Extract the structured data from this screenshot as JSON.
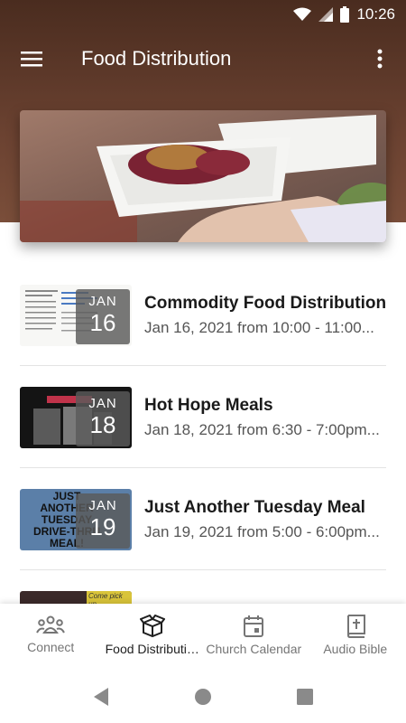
{
  "status_bar": {
    "time": "10:26"
  },
  "app_bar": {
    "title": "Food Distribution"
  },
  "events": [
    {
      "title": "Commodity Food Distribution",
      "subtitle": "Jan 16, 2021 from 10:00 - 11:00...",
      "month": "JAN",
      "day": "16"
    },
    {
      "title": "Hot Hope Meals",
      "subtitle": "Jan 18, 2021 from 6:30 - 7:00pm...",
      "month": "JAN",
      "day": "18"
    },
    {
      "title": "Just Another Tuesday Meal",
      "subtitle": "Jan 19, 2021 from 5:00 - 6:00pm...",
      "month": "JAN",
      "day": "19"
    }
  ],
  "thumbs": {
    "t3_text": "JUST ANOTHER TUESDAY DRIVE-THRU MEAL!",
    "t4_text": "Come pick up"
  },
  "bottom_nav": {
    "tabs": [
      {
        "label": "Connect",
        "icon": "people-icon"
      },
      {
        "label": "Food Distributi…",
        "icon": "box-icon"
      },
      {
        "label": "Church Calendar",
        "icon": "calendar-icon"
      },
      {
        "label": "Audio Bible",
        "icon": "bible-icon"
      }
    ],
    "active_index": 1
  },
  "colors": {
    "header": "#5a3526",
    "active_tab": "#1f1f1f",
    "inactive_tab": "#757575"
  }
}
